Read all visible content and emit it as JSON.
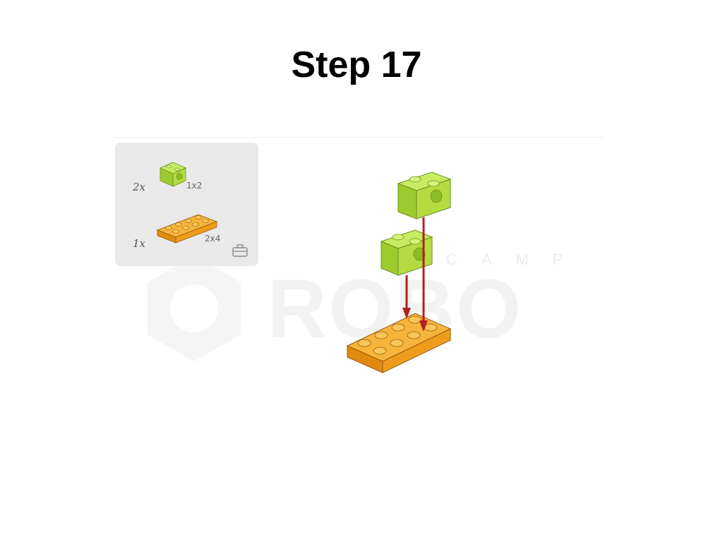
{
  "page": {
    "title": "Step 17"
  },
  "parts": [
    {
      "quantity": "2x",
      "size": "1x2",
      "color": "#a8d63a"
    },
    {
      "quantity": "1x",
      "size": "2x4",
      "color": "#f0a21e"
    }
  ],
  "watermark": {
    "top_text": "CAMP",
    "main_text": "ROBO"
  },
  "colors": {
    "lime_brick": "#a8d63a",
    "orange_plate": "#f0a21e",
    "arrow": "#b2201c",
    "panel_bg": "#e9e9e9"
  },
  "icons": {
    "panel_corner": "toolbox-icon",
    "watermark_logo": "hexagon-logo-icon"
  }
}
